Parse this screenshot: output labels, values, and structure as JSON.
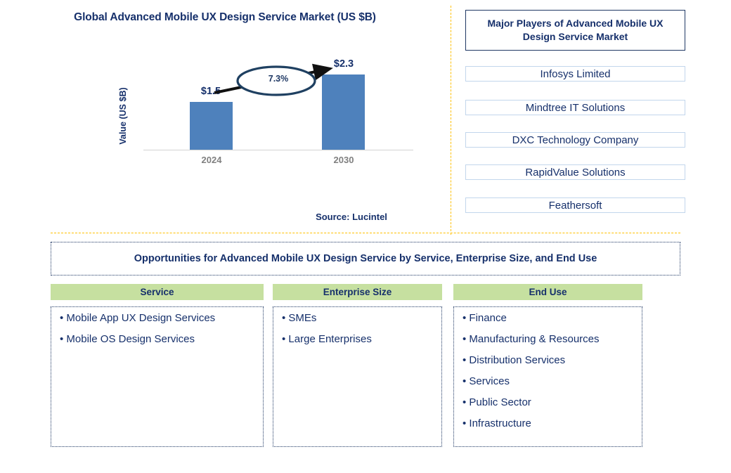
{
  "chart_panel": {
    "title": "Global Advanced Mobile UX Design Service Market (US $B)",
    "source": "Source: Lucintel"
  },
  "chart_data": {
    "type": "bar",
    "title": "Global Advanced Mobile UX Design Service Market (US $B)",
    "xlabel": "",
    "ylabel": "Value (US $B)",
    "categories": [
      "2024",
      "2030"
    ],
    "values": [
      1.5,
      2.3
    ],
    "value_labels": [
      "$1.5",
      "$2.3"
    ],
    "ylim": [
      0,
      2.6
    ],
    "grid": false,
    "legend": "none",
    "annotation": {
      "label": "7.3%",
      "meaning": "CAGR between 2024 and 2030",
      "shape": "ellipse-with-arrow"
    },
    "series_color": "#4E81BC"
  },
  "players_panel": {
    "title": "Major Players of Advanced Mobile UX Design Service Market",
    "items": [
      "Infosys Limited",
      "Mindtree IT Solutions",
      "DXC Technology Company",
      "RapidValue Solutions",
      "Feathersoft"
    ]
  },
  "opportunities": {
    "banner": "Opportunities for Advanced Mobile UX Design Service by Service, Enterprise Size, and End Use",
    "columns": [
      {
        "header": "Service",
        "items": [
          "Mobile App UX Design Services",
          "Mobile OS Design Services"
        ]
      },
      {
        "header": "Enterprise Size",
        "items": [
          "SMEs",
          "Large Enterprises"
        ]
      },
      {
        "header": "End Use",
        "items": [
          "Finance",
          "Manufacturing & Resources",
          "Distribution Services",
          "Services",
          "Public Sector",
          "Infrastructure"
        ]
      }
    ]
  },
  "colors": {
    "bar": "#4E81BC",
    "navy_text": "#16306B",
    "green_header": "#C6E0A0",
    "divider_yellow": "#FFC000",
    "player_border": "#C2D6EC"
  }
}
